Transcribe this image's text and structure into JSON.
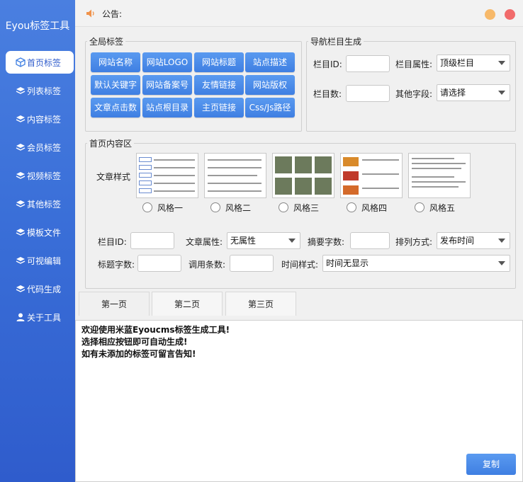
{
  "app": {
    "title": "Eyou标签工具"
  },
  "sidebar": {
    "items": [
      {
        "label": "首页标签",
        "icon": "cube-icon",
        "active": true
      },
      {
        "label": "列表标签",
        "icon": "layers-icon",
        "active": false
      },
      {
        "label": "内容标签",
        "icon": "layers-icon",
        "active": false
      },
      {
        "label": "会员标签",
        "icon": "layers-icon",
        "active": false
      },
      {
        "label": "视频标签",
        "icon": "layers-icon",
        "active": false
      },
      {
        "label": "其他标签",
        "icon": "layers-icon",
        "active": false
      },
      {
        "label": "模板文件",
        "icon": "layers-icon",
        "active": false
      },
      {
        "label": "可视编辑",
        "icon": "layers-icon",
        "active": false
      },
      {
        "label": "代码生成",
        "icon": "layers-icon",
        "active": false
      },
      {
        "label": "关于工具",
        "icon": "user-icon",
        "active": false
      }
    ]
  },
  "topbar": {
    "notice_label": "公告:"
  },
  "global_tags": {
    "legend": "全局标签",
    "buttons": [
      "网站名称",
      "网站LOGO",
      "网站标题",
      "站点描述",
      "默认关键字",
      "网站备案号",
      "友情链接",
      "网站版权",
      "文章点击数",
      "站点根目录",
      "主页链接",
      "Css/Js路径"
    ]
  },
  "nav_gen": {
    "legend": "导航栏目生成",
    "col_id_label": "栏目ID:",
    "col_attr_label": "栏目属性:",
    "col_attr_value": "顶级栏目",
    "col_count_label": "栏目数:",
    "other_field_label": "其他字段:",
    "other_field_value": "请选择"
  },
  "home_content": {
    "legend": "首页内容区",
    "article_style_label": "文章样式",
    "styles": [
      "风格一",
      "风格二",
      "风格三",
      "风格四",
      "风格五"
    ],
    "col_id_label": "栏目ID:",
    "article_attr_label": "文章属性:",
    "article_attr_value": "无属性",
    "summary_chars_label": "摘要字数:",
    "sort_label": "排列方式:",
    "sort_value": "发布时间",
    "title_chars_label": "标题字数:",
    "call_count_label": "调用条数:",
    "time_style_label": "时间样式:",
    "time_style_value": "时间无显示"
  },
  "tabs": [
    "第一页",
    "第二页",
    "第三页"
  ],
  "output": {
    "lines": [
      "欢迎使用米蓝Eyoucms标签生成工具!",
      "选择相应按钮即可自动生成!",
      "如有未添加的标签可留言告知!"
    ],
    "copy_label": "复制"
  },
  "colors": {
    "accent": "#3f7fe2",
    "sidebar": "#3a6fd8",
    "close": "#f16b6b",
    "minimize": "#f7b96a"
  }
}
